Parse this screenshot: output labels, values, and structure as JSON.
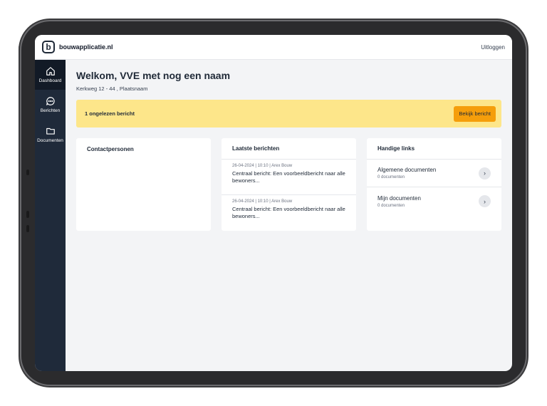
{
  "app": {
    "logo_mark": "b",
    "brand": "bouwapplicatie.nl",
    "logout_label": "Uitloggen"
  },
  "sidebar": {
    "items": [
      {
        "label": "Dashboard",
        "icon": "home-icon"
      },
      {
        "label": "Berichten",
        "icon": "chat-icon"
      },
      {
        "label": "Documenten",
        "icon": "folder-icon"
      }
    ]
  },
  "page": {
    "title": "Welkom, VVE met nog een naam",
    "subtitle": "Kerkweg 12 - 44 , Plaatsnaam"
  },
  "alert": {
    "text": "1 ongelezen bericht",
    "button_label": "Bekijk bericht"
  },
  "cards": {
    "contacts": {
      "title": "Contactpersonen"
    },
    "messages": {
      "title": "Laatste berichten",
      "items": [
        {
          "meta": "26-04-2024 | 10:10 | Arex Bouw",
          "body": "Centraal bericht: Een voorbeeldbericht naar alle bewoners..."
        },
        {
          "meta": "26-04-2024 | 10:10 | Arex Bouw",
          "body": "Centraal bericht: Een voorbeeldbericht naar alle bewoners..."
        }
      ]
    },
    "links": {
      "title": "Handige links",
      "items": [
        {
          "title": "Algemene documenten",
          "sub": "0 documenten"
        },
        {
          "title": "Mijn documenten",
          "sub": "0 documenten"
        }
      ]
    }
  },
  "colors": {
    "sidebar": "#1f2a3a",
    "alert_bg": "#fde68a",
    "alert_button": "#f59e0b",
    "page_bg": "#f3f4f6"
  }
}
